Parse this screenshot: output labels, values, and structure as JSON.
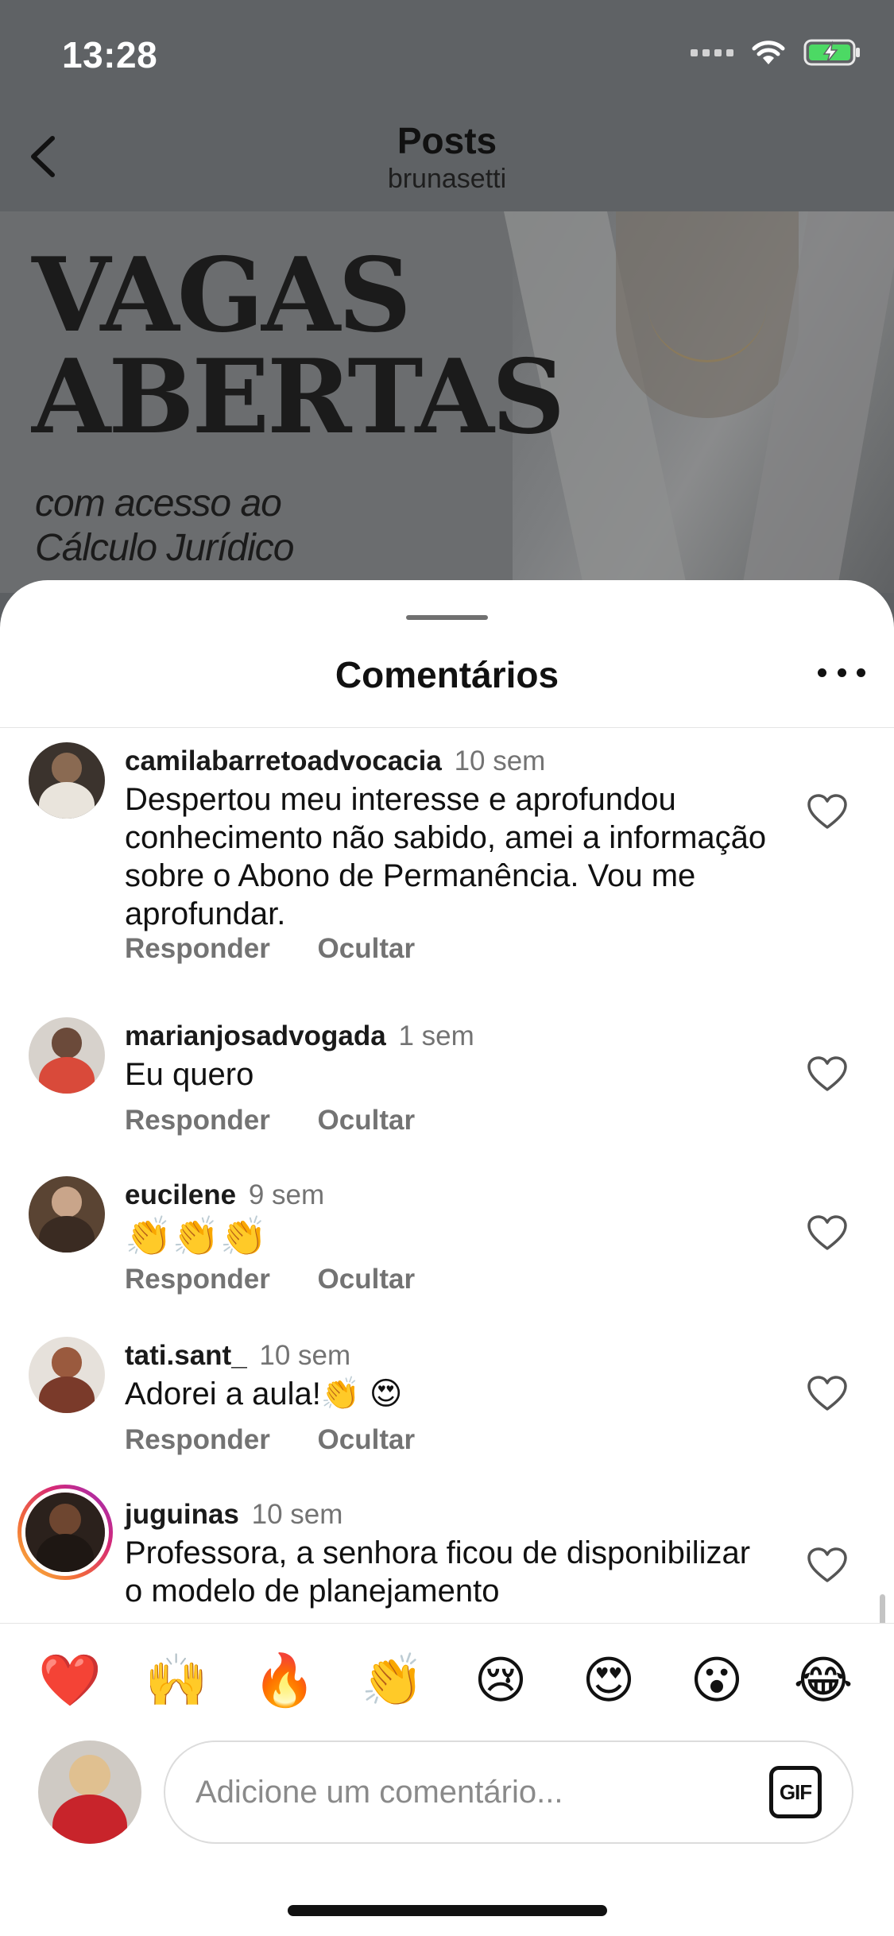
{
  "status_bar": {
    "time": "13:28"
  },
  "nav": {
    "title": "Posts",
    "subtitle": "brunasetti"
  },
  "post": {
    "headline_line1": "VAGAS",
    "headline_line2": "ABERTAS",
    "sub_line1": "com acesso ao",
    "sub_line2": "Cálculo Jurídico"
  },
  "sheet": {
    "title": "Comentários"
  },
  "comment_actions": {
    "reply": "Responder",
    "hide": "Ocultar"
  },
  "comments": [
    {
      "user": "camilabarretoadvocacia",
      "time": "10 sem",
      "text": "Despertou meu interesse e aprofundou conhecimento não sabido, amei a informação sobre o Abono de Permanência. Vou me aprofundar."
    },
    {
      "user": "marianjosadvogada",
      "time": "1 sem",
      "text": "Eu quero"
    },
    {
      "user": "eucilene",
      "time": "9 sem",
      "text": "👏👏👏"
    },
    {
      "user": "tati.sant_",
      "time": "10 sem",
      "text": "Adorei a aula!👏 😍"
    },
    {
      "user": "juguinas",
      "time": "10 sem",
      "text": "Professora, a senhora ficou de disponibilizar o modelo de planejamento"
    }
  ],
  "reactions": [
    "❤️",
    "🙌",
    "🔥",
    "👏",
    "😢",
    "😍",
    "😮",
    "😂"
  ],
  "composer": {
    "placeholder": "Adicione um comentário...",
    "gif_label": "GIF"
  },
  "colors": {
    "accent_ring": "#d62976",
    "muted_text": "#737373"
  }
}
